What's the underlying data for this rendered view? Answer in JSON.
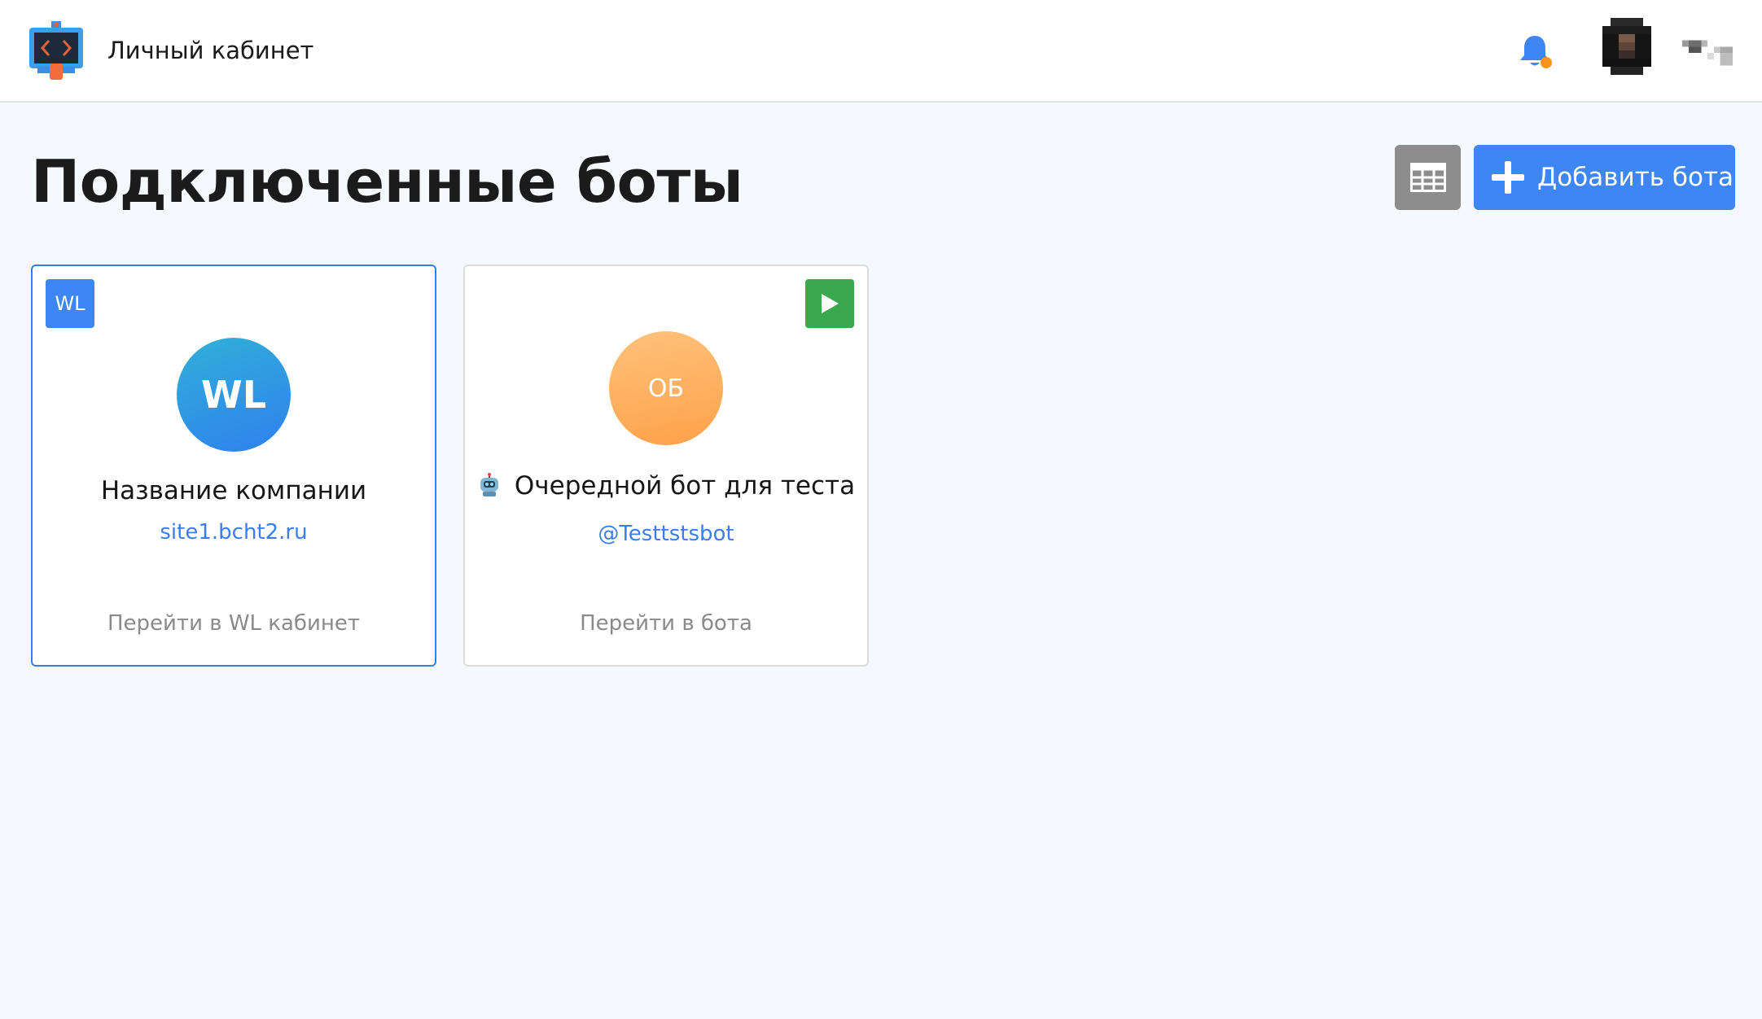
{
  "header": {
    "app_title": "Личный кабинет",
    "logo_icon": "code-screen-logo-icon",
    "notification_icon": "bell-icon",
    "notification_dot_color": "#f7941d",
    "user_avatar": "user-avatar",
    "menu_icon": "menu-icon"
  },
  "page": {
    "title": "Подключенные боты",
    "grid_view_icon": "table-grid-icon",
    "add_bot_label": "Добавить бота"
  },
  "cards": [
    {
      "badge": "WL",
      "avatar_initials": "WL",
      "name": "Название компании",
      "link": "site1.bcht2.ru",
      "action": "Перейти в WL кабинет",
      "selected": true
    },
    {
      "badge_icon": "play-icon",
      "avatar_initials": "ОБ",
      "name_icon": "robot-icon",
      "name": "Очередной бот для теста",
      "link": "@Testtstsbot",
      "action": "Перейти в бота",
      "selected": false
    }
  ],
  "colors": {
    "accent": "#3d86f4",
    "play_green": "#3aa84d",
    "background": "#f5f8fd"
  }
}
